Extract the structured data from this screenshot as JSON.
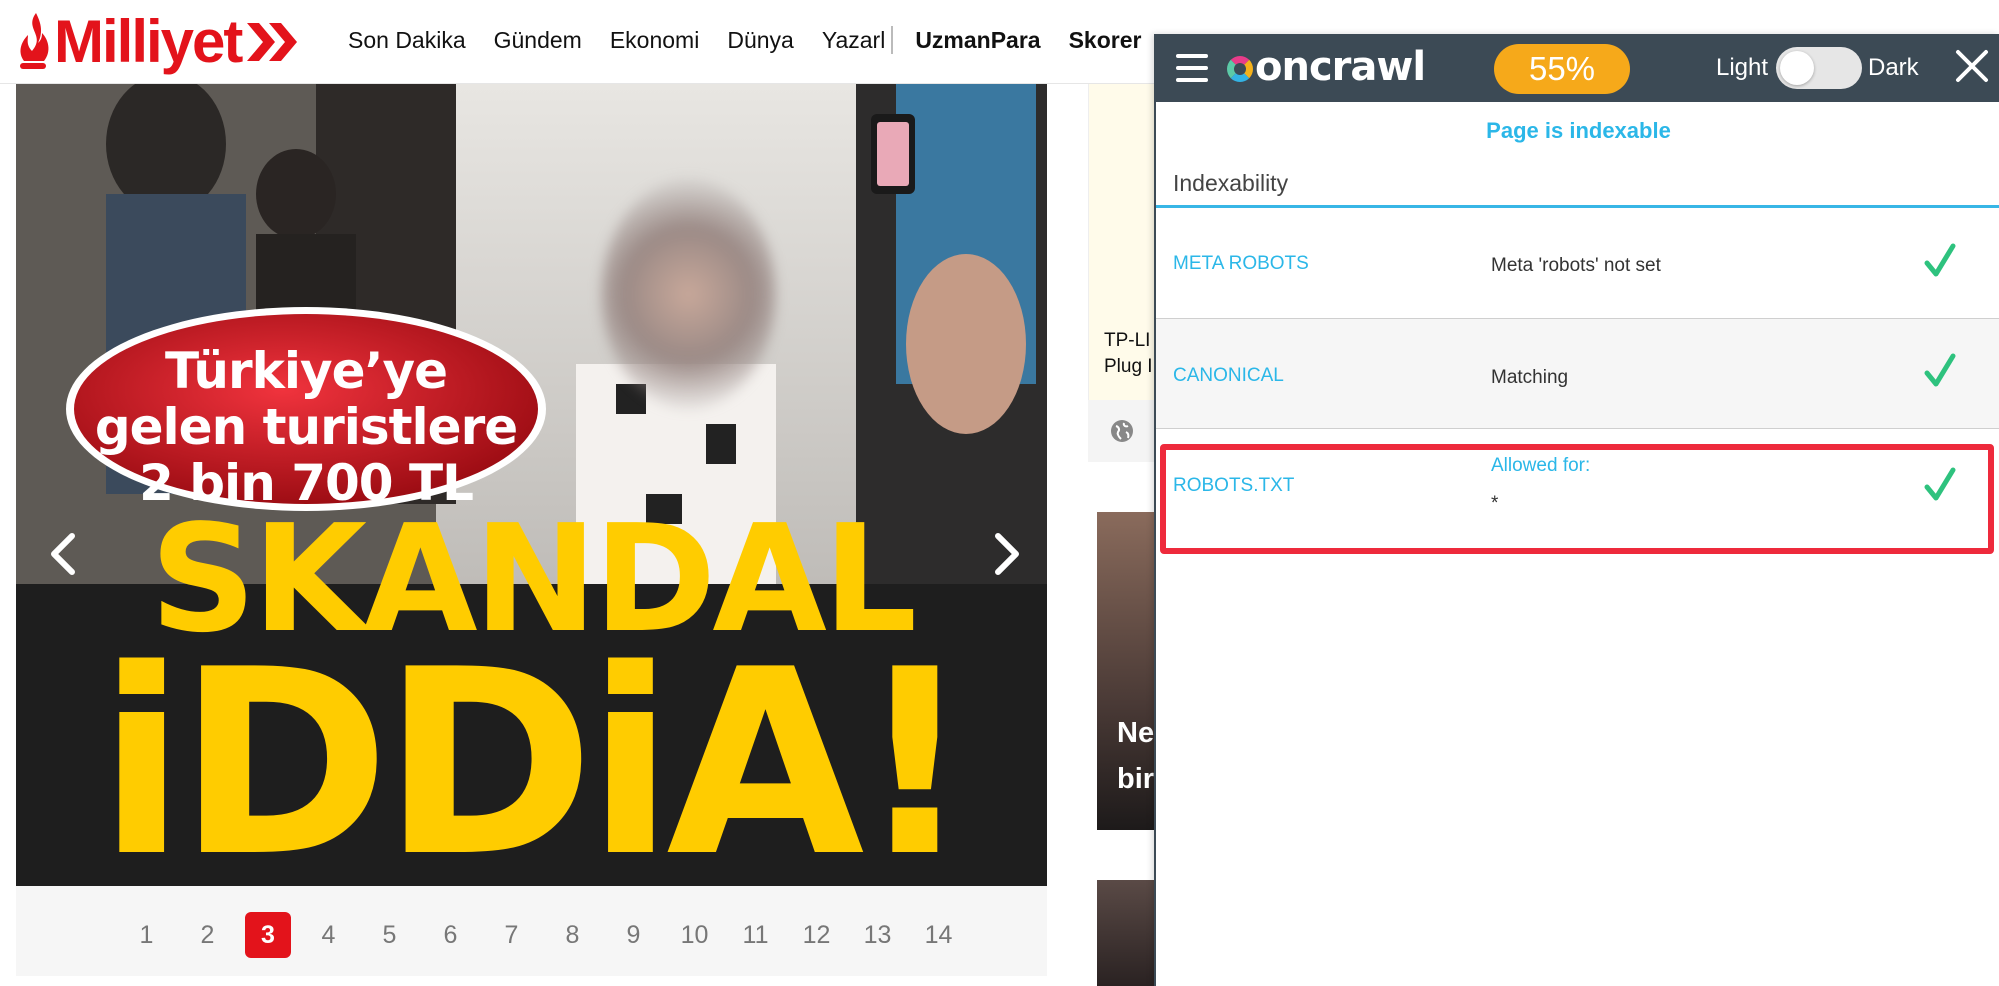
{
  "site": {
    "logo_text": "Milliyet",
    "brand_color": "#e3131b"
  },
  "nav": {
    "items": [
      "Son Dakika",
      "Gündem",
      "Ekonomi",
      "Dünya",
      "Yazarl"
    ],
    "bold_items": [
      "UzmanPara",
      "Skorer"
    ]
  },
  "slider": {
    "bubble_line1": "Türkiye’ye",
    "bubble_line2": "gelen turistlere",
    "bubble_line3": "2 bin 700 TL",
    "headline_top": "SKANDAL",
    "headline_bottom": "iDDiA!"
  },
  "pager": {
    "pages": [
      "1",
      "2",
      "3",
      "4",
      "5",
      "6",
      "7",
      "8",
      "9",
      "10",
      "11",
      "12",
      "13",
      "14"
    ],
    "active": "3"
  },
  "side": {
    "ad_line1": "TP-LI",
    "ad_line2": "Plug I",
    "card_line1": "Ne",
    "card_line2": "bir"
  },
  "oncrawl": {
    "brand": "oncrawl",
    "score": "55%",
    "theme_light_label": "Light",
    "theme_dark_label": "Dark",
    "status": "Page is indexable",
    "section_title": "Indexability",
    "rows": [
      {
        "label": "META ROBOTS",
        "value": "Meta 'robots' not set",
        "value2": ""
      },
      {
        "label": "CANONICAL",
        "value": "Matching",
        "value2": ""
      },
      {
        "label": "ROBOTS.TXT",
        "value": "Allowed for:",
        "value2": "*"
      }
    ],
    "check_color": "#2ec27e",
    "accent_color": "#2bb7e8",
    "bar_color": "#3c4a55",
    "score_color": "#f6a91a",
    "highlight_color": "#ee2a3c"
  }
}
